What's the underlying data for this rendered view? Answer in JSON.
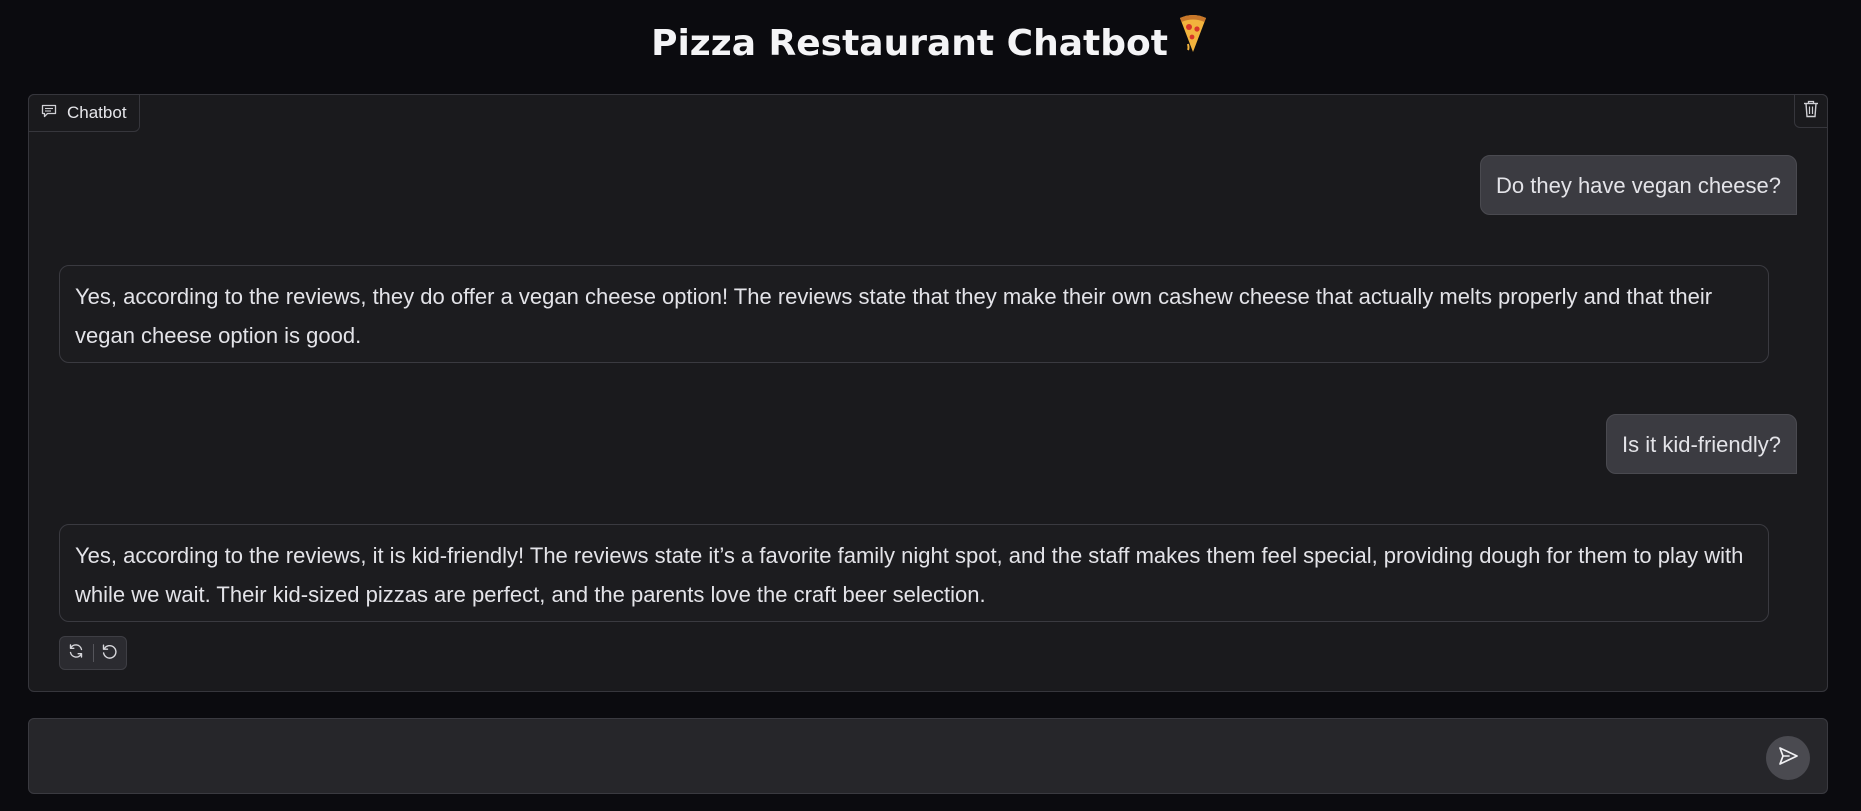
{
  "app": {
    "title": "Pizza Restaurant Chatbot",
    "title_emoji": "pizza-emoji"
  },
  "chatbot": {
    "label": "Chatbot",
    "label_icon": "chat-icon",
    "clear_icon": "trash-icon",
    "messages": [
      {
        "role": "user",
        "text": "Do they have vegan cheese?"
      },
      {
        "role": "bot",
        "text": "Yes, according to the reviews, they do offer a vegan cheese option! The reviews state that they make their own cashew cheese that actually melts properly and that their vegan cheese option is good."
      },
      {
        "role": "user",
        "text": "Is it kid-friendly?"
      },
      {
        "role": "bot",
        "text": "Yes, according to the reviews, it is kid-friendly! The reviews state it’s a favorite family night spot, and the staff makes them feel special, providing dough for them to play with while we wait. Their kid-sized pizzas are perfect, and the parents love the craft beer selection."
      }
    ],
    "actions": {
      "retry_icon": "retry-icon",
      "undo_icon": "undo-icon"
    }
  },
  "input": {
    "value": "",
    "placeholder": "",
    "send_icon": "send-icon"
  },
  "colors": {
    "background": "#0b0b0f",
    "panel": "#1a1a1d",
    "user_bubble": "#3b3b41",
    "input_bg": "#26262a"
  }
}
